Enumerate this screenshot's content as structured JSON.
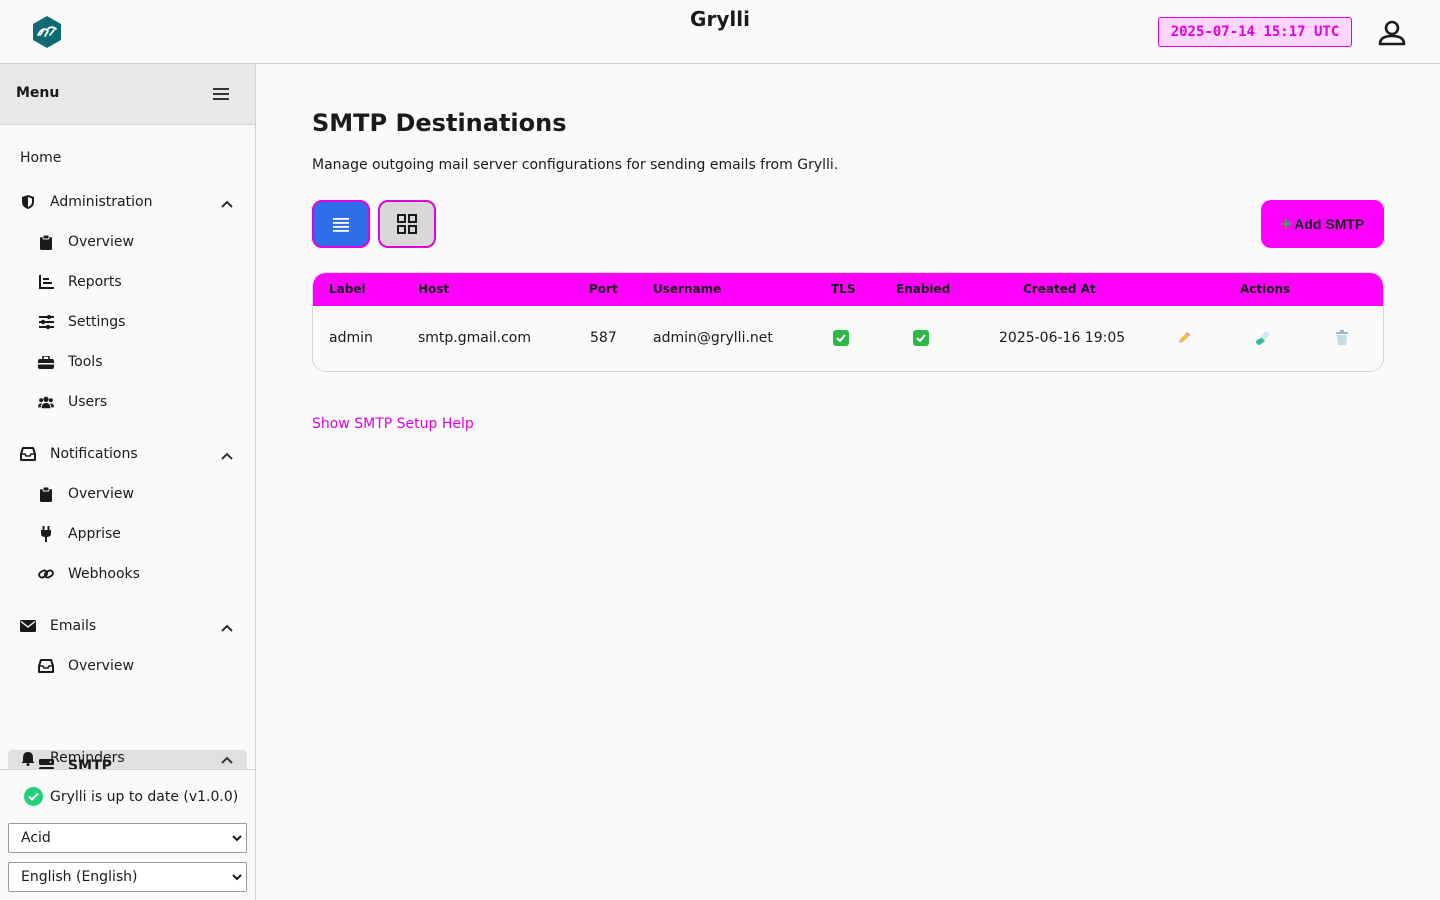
{
  "header": {
    "title": "Grylli",
    "clock": "2025-07-14 15:17 UTC"
  },
  "sidebar": {
    "menu_title": "Menu",
    "home": "Home",
    "sections": [
      {
        "label": "Administration",
        "items": [
          "Overview",
          "Reports",
          "Settings",
          "Tools",
          "Users"
        ]
      },
      {
        "label": "Notifications",
        "items": [
          "Overview",
          "Apprise",
          "Webhooks"
        ]
      },
      {
        "label": "Emails",
        "items": [
          "Overview",
          "SMTP"
        ]
      },
      {
        "label": "Reminders",
        "items": []
      }
    ],
    "active_item": "SMTP",
    "status": "Grylli is up to date (v1.0.0)",
    "theme_select": "Acid",
    "language_select": "English (English)"
  },
  "main": {
    "title": "SMTP Destinations",
    "description": "Manage outgoing mail server configurations for sending emails from Grylli.",
    "add_button": "Add SMTP",
    "help_link": "Show SMTP Setup Help",
    "table": {
      "columns": [
        "Label",
        "Host",
        "Port",
        "Username",
        "TLS",
        "Enabled",
        "Created At",
        "Actions"
      ],
      "rows": [
        {
          "label": "admin",
          "host": "smtp.gmail.com",
          "port": "587",
          "username": "admin@grylli.net",
          "tls": true,
          "enabled": true,
          "created_at": "2025-06-16 19:05"
        }
      ]
    }
  },
  "colors": {
    "accent": "#ff00ff",
    "accent_text": "#e000e0",
    "primary_blue": "#2f6ee8",
    "success": "#2fb84a",
    "logo": "#0e6b75"
  },
  "icons": {
    "logo": "grylli-logo",
    "user": "user-icon",
    "menu": "hamburger-icon",
    "view_list": "list-icon",
    "view_grid": "grid-icon",
    "edit": "pencil-icon",
    "test": "test-tube-icon",
    "delete": "trash-icon"
  }
}
